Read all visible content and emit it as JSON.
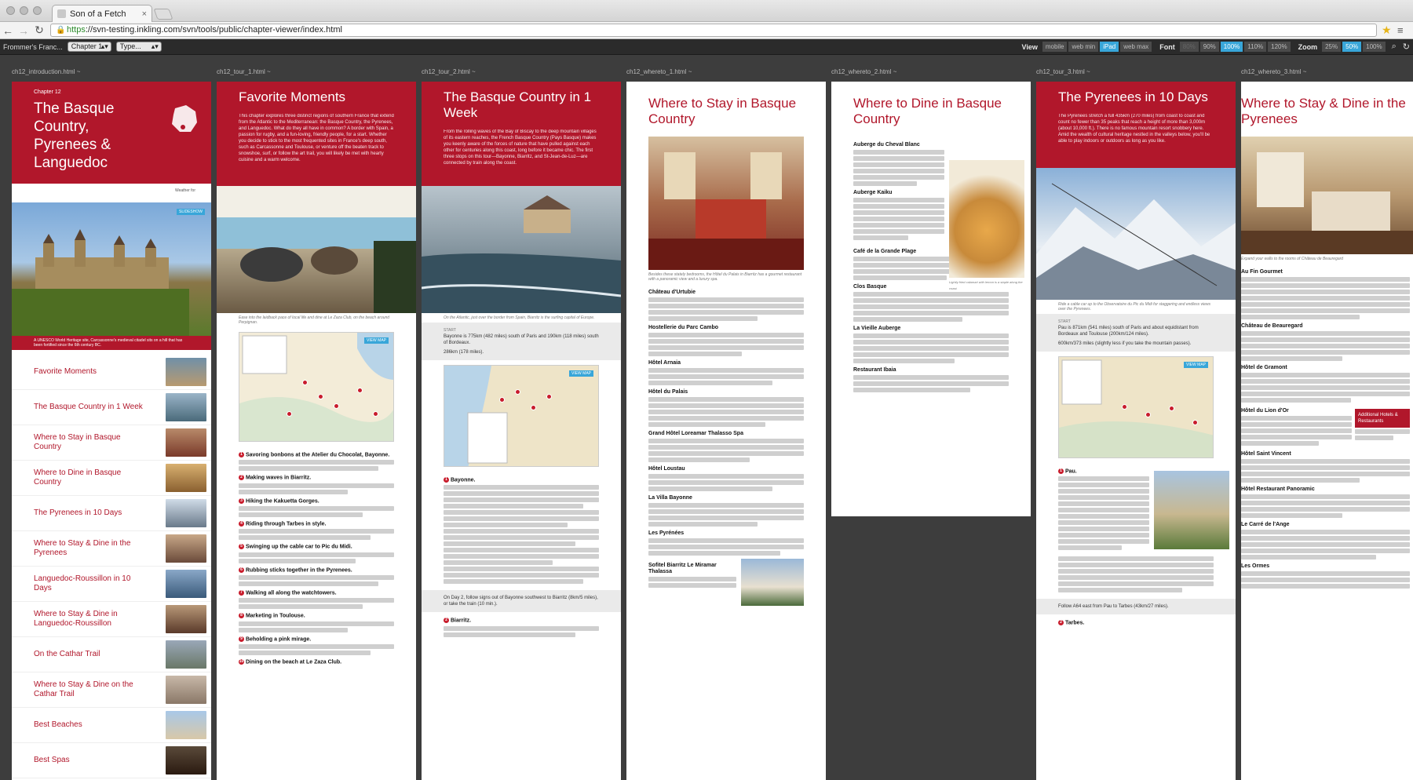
{
  "browser": {
    "tab_title": "Son of a Fetch",
    "tab_close": "×",
    "url_scheme": "https",
    "url_rest": "://svn-testing.inkling.com/svn/tools/public/chapter-viewer/index.html"
  },
  "toolbar": {
    "book": "Frommer's Franc...",
    "chapter": "Chapter 1",
    "type": "Type...",
    "view_label": "View",
    "views": [
      "mobile",
      "web min",
      "iPad",
      "web max"
    ],
    "font_label": "Font",
    "fonts": [
      "80%",
      "90%",
      "100%",
      "110%",
      "120%"
    ],
    "zoom_label": "Zoom",
    "zooms": [
      "25%",
      "50%",
      "100%"
    ]
  },
  "columns": [
    {
      "file": "ch12_introduction.html ~"
    },
    {
      "file": "ch12_tour_1.html ~"
    },
    {
      "file": "ch12_tour_2.html ~"
    },
    {
      "file": "ch12_whereto_1.html ~"
    },
    {
      "file": "ch12_whereto_2.html ~"
    },
    {
      "file": "ch12_tour_3.html ~"
    },
    {
      "file": "ch12_whereto_3.html ~"
    }
  ],
  "intro": {
    "chapter": "Chapter 12",
    "title": "The Basque Country, Pyrenees & Languedoc",
    "weather": "Weather for",
    "slideshow": "SLIDESHOW",
    "caption": "A UNESCO World Heritage site, Carcassonne's medieval citadel sits on a hill that has been fortified since the 6th century BC.",
    "toc": [
      "Favorite Moments",
      "The Basque Country in 1 Week",
      "Where to Stay in Basque Country",
      "Where to Dine in Basque Country",
      "The Pyrenees in 10 Days",
      "Where to Stay & Dine in the Pyrenees",
      "Languedoc-Roussillon in 10 Days",
      "Where to Stay & Dine in Languedoc-Roussillon",
      "On the Cathar Trail",
      "Where to Stay & Dine on the Cathar Trail",
      "Best Beaches",
      "Best Spas"
    ]
  },
  "tour1": {
    "title": "Favorite Moments",
    "intro": "This chapter explores three distinct regions of southern France that extend from the Atlantic to the Mediterranean: the Basque Country, the Pyrenees, and Languedoc. What do they all have in common? A border with Spain, a passion for rugby, and a fun-loving, friendly people, for a start. Whether you decide to stick to the most frequented sites in France's deep south, such as Carcassonne and Toulouse, or venture off the beaten track to snowshoe, surf, or follow the art trail, you will likely be met with hearty cuisine and a warm welcome.",
    "caption": "Ease into the laidback pace of local life and dine at Le Zaza Club, on the beach around Perpignan.",
    "items": [
      "Savoring bonbons at the Atelier du Chocolat, Bayonne.",
      "Making waves in Biarritz.",
      "Hiking the Kakuetta Gorges.",
      "Riding through Tarbes in style.",
      "Swinging up the cable car to Pic du Midi.",
      "Rubbing sticks together in the Pyrenees.",
      "Walking all along the watchtowers.",
      "Marketing in Toulouse.",
      "Beholding a pink mirage.",
      "Dining on the beach at Le Zaza Club."
    ]
  },
  "tour2": {
    "title": "The Basque Country in 1 Week",
    "intro": "From the rolling waves of the Bay of Biscay to the deep mountain villages of its eastern reaches, the French Basque Country (Pays Basque) makes you keenly aware of the forces of nature that have pulled against each other for centuries along this coast, long before it became chic. The first three stops on this tour—Bayonne, Biarritz, and St-Jean-de-Luz—are connected by train along the coast.",
    "caption": "On the Atlantic, just over the border from Spain, Biarritz is the surfing capital of Europe.",
    "start_label": "START",
    "start": "Bayonne is 775km (482 miles) south of Paris and 190km (118 miles) south of Bordeaux.",
    "length": "286km (178 miles).",
    "view_map": "VIEW MAP",
    "stop1": "Bayonne.",
    "stop2": "Biarritz.",
    "day2": "On Day 2, follow signs out of Bayonne southwest to Biarritz (8km/5 miles), or take the train (10 min.)."
  },
  "stay1": {
    "title": "Where to Stay in Basque Country",
    "caption": "Besides these stately bedrooms, the Hôtel du Palais in Biarritz has a gourmet restaurant with a panoramic view and a luxury spa.",
    "hotels": [
      "Château d'Urtubie",
      "Hostellerie du Parc Cambo",
      "Hôtel Arnaia",
      "Hôtel du Palais",
      "Grand Hôtel Loreamar Thalasso Spa",
      "Hôtel Loustau",
      "La Villa Bayonne",
      "Les Pyrénées",
      "Sofitel Biarritz Le Miramar Thalassa"
    ]
  },
  "dine1": {
    "title": "Where to Dine in Basque Country",
    "caption": "Lightly fried calamari with lemon is a staple along the coast.",
    "restaurants": [
      "Auberge du Cheval Blanc",
      "Auberge Kaiku",
      "Café de la Grande Plage",
      "Clos Basque",
      "La Vieille Auberge",
      "Restaurant Ibaia"
    ]
  },
  "tour3": {
    "title": "The Pyrenees in 10 Days",
    "intro": "The Pyrenees stretch a full 435km (270 miles) from coast to coast and count no fewer than 35 peaks that reach a height of more than 3,000m (about 10,000 ft.). There is no famous mountain resort snobbery here. Amid the wealth of cultural heritage nestled in the valleys below, you'll be able to play indoors or outdoors as long as you like.",
    "caption": "Ride a cable car up to the Observatoire du Pic du Midi for staggering and endless views over the Pyrenees.",
    "start": "Pau is 871km (541 miles) south of Paris and about equidistant from Bordeaux and Toulouse (200km/124 miles).",
    "length": "600km/373 miles (slightly less if you take the mountain passes).",
    "stop1": "Pau.",
    "stop2": "Tarbes.",
    "follow": "Follow A64 east from Pau to Tarbes (43km/27 miles)."
  },
  "stay3": {
    "title": "Where to Stay & Dine in the Pyrenees",
    "caption": "Expand your walls to the rooms of Château de Beauregard",
    "items": [
      "Au Fin Gourmet",
      "Château de Beauregard",
      "Hôtel de Gramont",
      "Hôtel du Lion d'Or",
      "Hôtel Saint Vincent",
      "Hôtel Restaurant Panoramic",
      "Le Carré de l'Ange",
      "Les Ormes"
    ],
    "additional": "Additional Hotels & Restaurants"
  }
}
